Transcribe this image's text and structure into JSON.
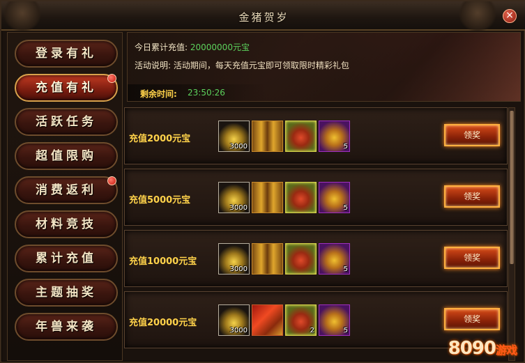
{
  "window": {
    "title": "金猪贺岁"
  },
  "sidebar": {
    "items": [
      {
        "label": "登录有礼",
        "active": false,
        "badge": false
      },
      {
        "label": "充值有礼",
        "active": true,
        "badge": true
      },
      {
        "label": "活跃任务",
        "active": false,
        "badge": false
      },
      {
        "label": "超值限购",
        "active": false,
        "badge": false
      },
      {
        "label": "消费返利",
        "active": false,
        "badge": true
      },
      {
        "label": "材料竞技",
        "active": false,
        "badge": false
      },
      {
        "label": "累计充值",
        "active": false,
        "badge": false
      },
      {
        "label": "主题抽奖",
        "active": false,
        "badge": false
      },
      {
        "label": "年兽来袭",
        "active": false,
        "badge": false
      }
    ]
  },
  "info": {
    "today_label": "今日累计充值:",
    "today_value": "20000000元宝",
    "desc_label": "活动说明:",
    "desc_text": "活动期间，每天充值元宝即可领取限时精彩礼包",
    "timer_label": "剩余时间:",
    "timer_value": "23:50:26"
  },
  "rewards": [
    {
      "label": "充值2000元宝",
      "button": "领奖",
      "items": [
        {
          "icon": "gold-ingot-icon",
          "qty": "3000"
        },
        {
          "icon": "scroll-icon",
          "qty": ""
        },
        {
          "icon": "red-pouch-icon",
          "qty": ""
        },
        {
          "icon": "gift-bag-icon",
          "qty": "5"
        }
      ]
    },
    {
      "label": "充值5000元宝",
      "button": "领奖",
      "items": [
        {
          "icon": "gold-ingot-icon",
          "qty": "3000"
        },
        {
          "icon": "scroll-icon",
          "qty": ""
        },
        {
          "icon": "red-pouch-icon",
          "qty": ""
        },
        {
          "icon": "gift-bag-icon",
          "qty": "5"
        }
      ]
    },
    {
      "label": "充值10000元宝",
      "button": "领奖",
      "items": [
        {
          "icon": "gold-ingot-icon",
          "qty": "3000"
        },
        {
          "icon": "scroll-icon",
          "qty": ""
        },
        {
          "icon": "red-pouch-icon",
          "qty": ""
        },
        {
          "icon": "gift-bag-icon",
          "qty": "5"
        }
      ]
    },
    {
      "label": "充值20000元宝",
      "button": "领奖",
      "items": [
        {
          "icon": "gold-ingot-icon",
          "qty": "3000"
        },
        {
          "icon": "red-scroll-icon",
          "qty": ""
        },
        {
          "icon": "red-pouch-icon",
          "qty": "2"
        },
        {
          "icon": "gift-bag-icon",
          "qty": "5"
        }
      ]
    }
  ],
  "watermark": {
    "brand": "8090",
    "suffix": "游戏"
  }
}
